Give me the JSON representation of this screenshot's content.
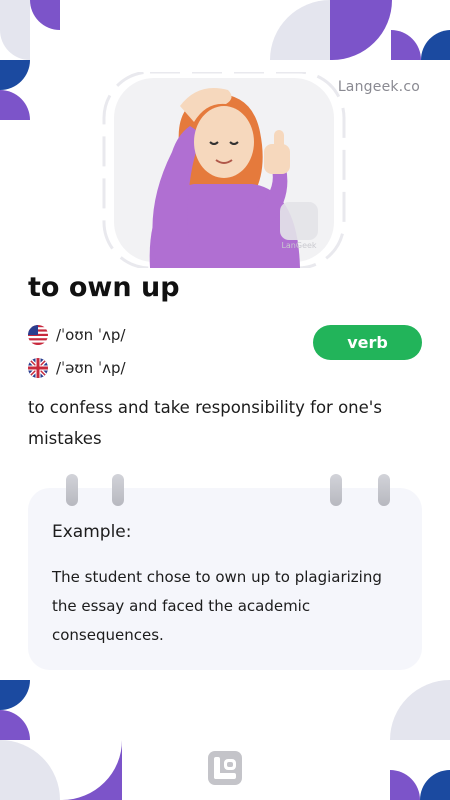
{
  "brand": {
    "name": "Langeek.co"
  },
  "entry": {
    "word": "to own up",
    "part_of_speech": "verb",
    "pronunciations": [
      {
        "region": "US",
        "flag_icon": "us-flag-icon",
        "ipa": "/ˈoʊn ˈʌp/"
      },
      {
        "region": "UK",
        "flag_icon": "uk-flag-icon",
        "ipa": "/ˈəʊn ˈʌp/"
      }
    ],
    "definition": "to confess and take responsibility for one's mistakes"
  },
  "example": {
    "label": "Example:",
    "text": "The student chose to own up to plagiarizing the essay and faced the academic consequences."
  },
  "illustration": {
    "icon": "person-confessing-illustration",
    "watermark": "LanGeek"
  },
  "colors": {
    "accent_purple": "#7c54c9",
    "accent_blue": "#1b4aa0",
    "decor_gray": "#e4e5ee",
    "badge_green": "#22b45a",
    "card_bg": "#f5f6fb"
  }
}
